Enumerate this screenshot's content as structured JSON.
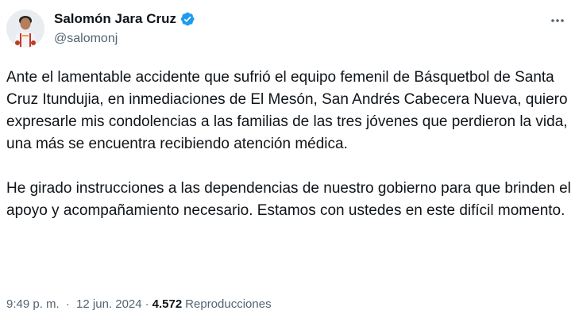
{
  "author": {
    "display_name": "Salomón Jara Cruz",
    "handle": "@salomonj",
    "verified": true,
    "avatar_icon": "profile-photo",
    "verified_icon": "verified-badge-icon"
  },
  "menu": {
    "more_icon": "more-options-icon"
  },
  "tweet": {
    "paragraph_1": "Ante el lamentable accidente que sufrió el equipo femenil de Básquetbol de Santa Cruz Itundujia, en inmediaciones de El Mesón, San Andrés Cabecera Nueva, quiero expresarle mis condolencias a las familias de las tres jóvenes que perdieron la vida, una más se encuentra recibiendo atención médica.",
    "paragraph_2": "He girado instrucciones a las dependencias de nuestro gobierno para que brinden el apoyo y acompañamiento necesario. Estamos con ustedes en este difícil momento."
  },
  "meta": {
    "time": "9:49 p. m.",
    "separator": "·",
    "date": "12 jun. 2024",
    "views_count": "4.572",
    "views_label": "Reproducciones"
  },
  "colors": {
    "text_primary": "#0f1419",
    "text_secondary": "#536471",
    "verified_blue": "#1d9bf0"
  }
}
